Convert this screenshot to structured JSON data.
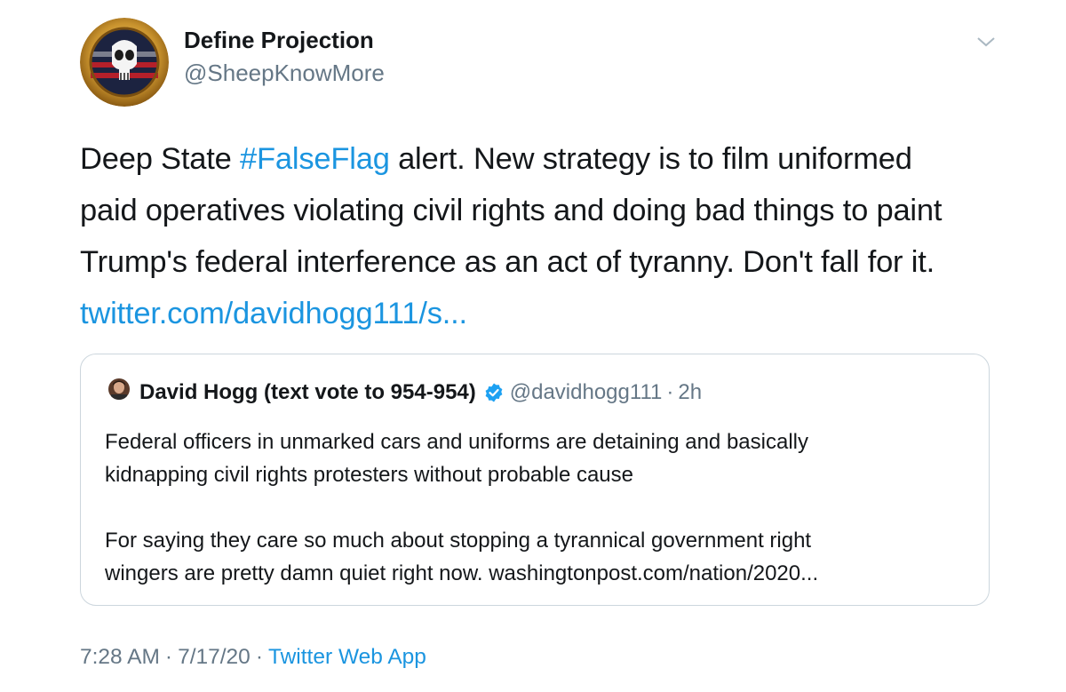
{
  "author": {
    "display_name": "Define Projection",
    "handle": "@SheepKnowMore"
  },
  "tweet": {
    "text_lines": [
      {
        "before": "Deep State ",
        "hashtag": "#FalseFlag",
        "after": " alert. New strategy is to film uniformed"
      },
      "paid operatives violating civil rights and doing bad things to paint",
      "Trump's federal interference as an act of tyranny. Don't fall for it."
    ],
    "link": "twitter.com/davidhogg111/s..."
  },
  "quoted_tweet": {
    "name": "David Hogg (text vote to 954-954)",
    "handle": "@davidhogg111",
    "separator": "·",
    "time": "2h",
    "paragraph1_lines": [
      "Federal officers in unmarked cars and uniforms are detaining and basically",
      "kidnapping civil rights protesters without probable cause"
    ],
    "paragraph2_lines": [
      "For saying they care so much about stopping a tyrannical government right",
      "wingers are pretty damn quiet right now. washingtonpost.com/nation/2020..."
    ]
  },
  "footer": {
    "time": "7:28 AM",
    "separator": "·",
    "date": "7/17/20",
    "source": "Twitter Web App"
  },
  "icons": {
    "avatar": "punisher-skull-emblem",
    "more": "chevron-down-icon",
    "verified": "verified-badge-icon"
  },
  "colors": {
    "link": "#1b95e0",
    "secondary_text": "#657786",
    "border": "#ccd6dd",
    "text": "#14171a"
  }
}
